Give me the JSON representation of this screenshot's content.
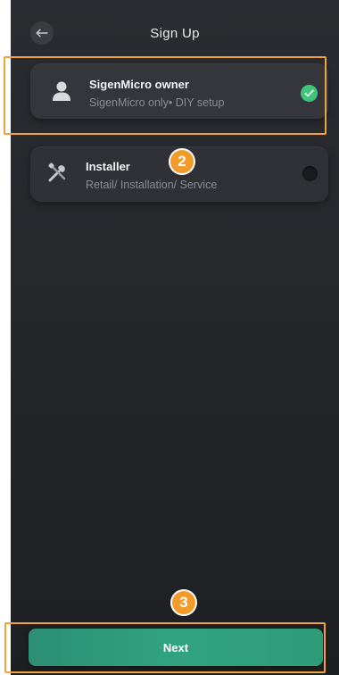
{
  "header": {
    "title": "Sign Up",
    "back_icon": "arrow-left-icon"
  },
  "roles": [
    {
      "name": "SigenMicro owner",
      "description": "SigenMicro only• DIY setup",
      "icon": "user-icon",
      "selected": true
    },
    {
      "name": "Installer",
      "description": "Retail/ Installation/ Service",
      "icon": "wrench-screwdriver-icon",
      "selected": false
    }
  ],
  "steps": {
    "two": "2",
    "three": "3"
  },
  "footer": {
    "next_label": "Next"
  },
  "colors": {
    "accent_green": "#3fc67d",
    "button_green": "#31a37f",
    "highlight_orange": "#f2a23a",
    "background": "#25272b"
  }
}
